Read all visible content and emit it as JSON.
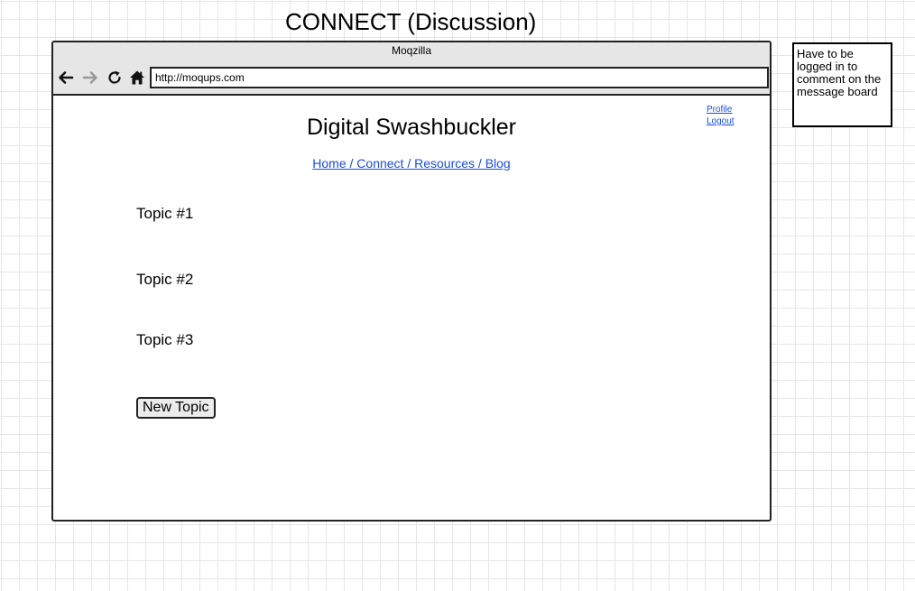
{
  "heading": "CONNECT (Discussion)",
  "browser": {
    "title": "Moqzilla",
    "url": "http://moqups.com",
    "icons": [
      "back-arrow-icon",
      "forward-arrow-icon",
      "reload-icon",
      "home-icon"
    ]
  },
  "site": {
    "title": "Digital Swashbuckler",
    "nav": "Home / Connect / Resources / Blog",
    "user_links": {
      "profile": "Profile",
      "logout": "Logout"
    }
  },
  "topics": [
    "Topic #1",
    "Topic #2",
    "Topic #3"
  ],
  "new_topic_button": "New Topic",
  "note": "Have to be logged in to comment on the message board",
  "colors": {
    "link": "#1a4ddb",
    "chrome": "#e6e6e6",
    "forward_disabled": "#9a9a9a"
  }
}
